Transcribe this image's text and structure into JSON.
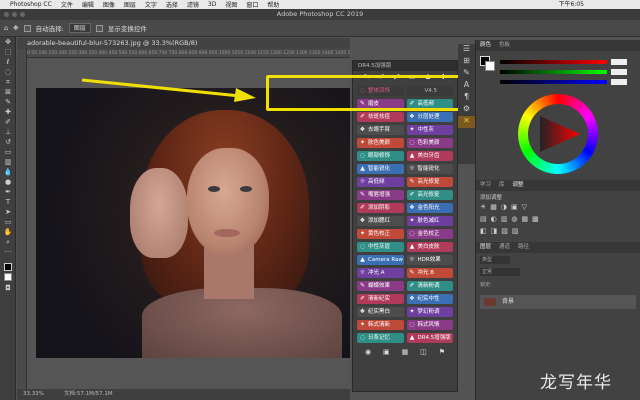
{
  "menubar": {
    "items": [
      "Photoshop CC",
      "文件",
      "编辑",
      "图像",
      "图层",
      "文字",
      "选择",
      "滤镜",
      "3D",
      "视图",
      "窗口",
      "帮助"
    ],
    "time": "下午6:05"
  },
  "window": {
    "title": "Adobe Photoshop CC 2019"
  },
  "options": {
    "auto_select_label": "自动选择:",
    "auto_select_value": "图层",
    "show_transform_label": "显示变换控件"
  },
  "document": {
    "tab_title": "adorable-beautiful-blur-573263.jpg @ 33.3%(RGB/8)",
    "ruler_ticks": "0 50 100 150 200 250 300 350 400 450 500 550 600 650 700 750 800 850 900 950 1000 1050 1100 1150 1200 1250 1300 1350 1400 1450 1500 1550 1600 1650 1700 1750"
  },
  "status": {
    "zoom": "33.33%",
    "doc_size": "文档:57.1M/57.1M"
  },
  "plugin": {
    "title": "DR4.5加强版",
    "top_buttons": {
      "left_label": "整体润饰",
      "version": "V4.5"
    },
    "buttons": [
      [
        "磨皮",
        "高低频"
      ],
      [
        "祛斑祛痘",
        "分层处理"
      ],
      [
        "去眼手臂",
        "中性灰"
      ],
      [
        "肤色美颜",
        "色彩美颜"
      ],
      [
        "眼部修饰",
        "美白牙齿"
      ],
      [
        "智能锐化",
        "智能锐化"
      ],
      [
        "高低频",
        "高光修复"
      ],
      [
        "嘴唇增强",
        "高光修复"
      ],
      [
        "添加阴影",
        "金色阳光"
      ],
      [
        "添加腮红",
        "肤色减红"
      ],
      [
        "黄色校正",
        "金色校正"
      ],
      [
        "中性灰层",
        "美白皮肤"
      ],
      [
        "Camera Raw",
        "HDR效果"
      ],
      [
        "冲光 A",
        "冲光 B"
      ],
      [
        "蝴蝶效果",
        "清新粉调"
      ],
      [
        "清新纪实",
        "纪实中性"
      ],
      [
        "纪实黑白",
        "梦幻粉调"
      ],
      [
        "韩式清新",
        "韩式风情"
      ],
      [
        "日系记忆",
        "DR4.5增强版"
      ]
    ]
  },
  "right_panel": {
    "color_tabs": [
      "颜色",
      "色板"
    ],
    "mid_tabs": [
      "学习",
      "库",
      "调整"
    ],
    "adjust_label": "添加调整",
    "layer_tabs": [
      "图层",
      "通道",
      "路径"
    ],
    "layer_kind": "类型",
    "blend_mode": "正常",
    "lock_label": "锁定:",
    "layer_name": "背景"
  },
  "watermark": "龙写年华",
  "colors": {
    "highlight_border": "#f0e000",
    "arrow": "#f0e000",
    "button_palette": [
      "#8a3b87",
      "#2f8f86",
      "#b03a59",
      "#3b6fb3",
      "#4d4d4d",
      "#6f3fa0",
      "#c04a3a"
    ]
  }
}
